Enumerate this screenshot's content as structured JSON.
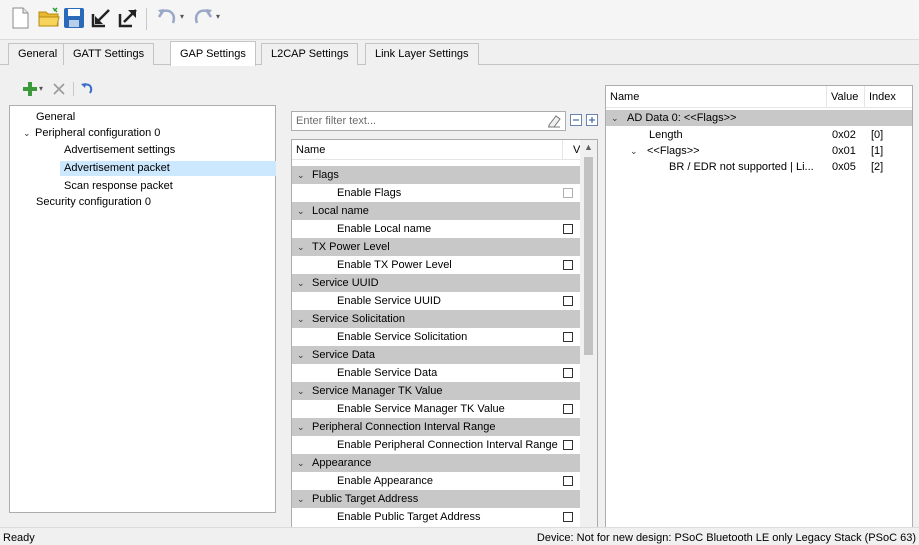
{
  "toolbar": {
    "icons": [
      "new-file-icon",
      "open-folder-icon",
      "save-icon",
      "import-icon",
      "export-icon",
      "undo-icon",
      "redo-icon"
    ]
  },
  "tabs": [
    {
      "label": "General",
      "active": false
    },
    {
      "label": "GATT Settings",
      "active": false
    },
    {
      "label": "GAP Settings",
      "active": true
    },
    {
      "label": "L2CAP Settings",
      "active": false
    },
    {
      "label": "Link Layer Settings",
      "active": false
    }
  ],
  "left_tree": {
    "items": [
      {
        "label": "General"
      },
      {
        "label": "Peripheral configuration 0"
      },
      {
        "label": "Advertisement settings"
      },
      {
        "label": "Advertisement packet"
      },
      {
        "label": "Scan response packet"
      },
      {
        "label": "Security configuration 0"
      }
    ]
  },
  "filter": {
    "placeholder": "Enter filter text..."
  },
  "mid_list": {
    "col_name": "Name",
    "col_value": "V",
    "rows": [
      {
        "label": "Flags"
      },
      {
        "label": "Enable Flags"
      },
      {
        "label": "Local name"
      },
      {
        "label": "Enable Local name"
      },
      {
        "label": "TX Power Level"
      },
      {
        "label": "Enable TX Power Level"
      },
      {
        "label": "Service UUID"
      },
      {
        "label": "Enable Service UUID"
      },
      {
        "label": "Service Solicitation"
      },
      {
        "label": "Enable Service Solicitation"
      },
      {
        "label": "Service Data"
      },
      {
        "label": "Enable Service Data"
      },
      {
        "label": "Service Manager TK Value"
      },
      {
        "label": "Enable Service Manager TK Value"
      },
      {
        "label": "Peripheral Connection Interval Range"
      },
      {
        "label": "Enable Peripheral Connection Interval Range"
      },
      {
        "label": "Appearance"
      },
      {
        "label": "Enable Appearance"
      },
      {
        "label": "Public Target Address"
      },
      {
        "label": "Enable Public Target Address"
      }
    ]
  },
  "right_panel": {
    "col_name": "Name",
    "col_value": "Value",
    "col_index": "Index",
    "rows": [
      {
        "name": "AD Data 0: <<Flags>>",
        "value": "",
        "index": ""
      },
      {
        "name": "Length",
        "value": "0x02",
        "index": "[0]"
      },
      {
        "name": "<<Flags>>",
        "value": "0x01",
        "index": "[1]"
      },
      {
        "name": "BR / EDR not supported | Li...",
        "value": "0x05",
        "index": "[2]"
      }
    ]
  },
  "status": {
    "left": "Ready",
    "right": "Device: Not for new design: PSoC Bluetooth LE only Legacy Stack (PSoC 63)"
  }
}
